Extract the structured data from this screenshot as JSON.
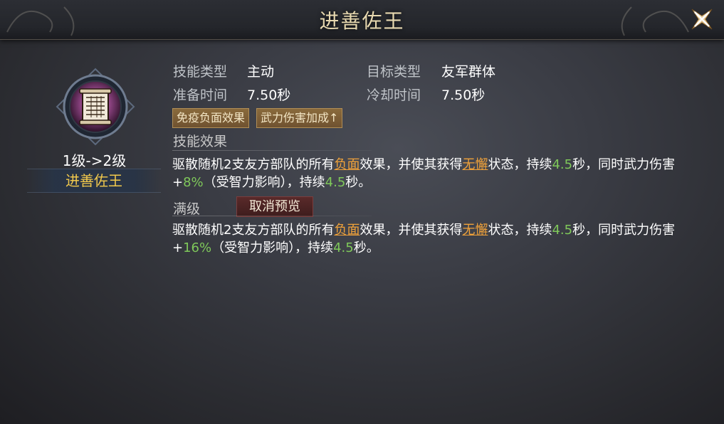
{
  "window": {
    "title": "进善佐王"
  },
  "skill": {
    "level_change": "1级->2级",
    "name": "进善佐王",
    "icon": "scroll-icon"
  },
  "stats": {
    "skill_type_label": "技能类型",
    "skill_type_value": "主动",
    "target_type_label": "目标类型",
    "target_type_value": "友军群体",
    "prep_time_label": "准备时间",
    "prep_time_value": "7.50秒",
    "cooldown_label": "冷却时间",
    "cooldown_value": "7.50秒"
  },
  "tags": [
    "免疫负面效果",
    "武力伤害加成↑"
  ],
  "effect_section": {
    "title": "技能效果",
    "parts": {
      "p1": "驱散随机2支友方部队的所有",
      "neg": "负面",
      "p2": "效果，并使其获得",
      "status": "无懈",
      "p3": "状态，持续",
      "dur1": "4.5",
      "p4": "秒，同时武力伤害+",
      "pct": "8%",
      "p5": "（受智力影响），持续",
      "dur2": "4.5",
      "p6": "秒。"
    }
  },
  "max_section": {
    "title": "满级",
    "cancel_preview": "取消预览",
    "parts": {
      "p1": "驱散随机2支友方部队的所有",
      "neg": "负面",
      "p2": "效果，并使其获得",
      "status": "无懈",
      "p3": "状态，持续",
      "dur1": "4.5",
      "p4": "秒，同时武力伤害+",
      "pct": "16%",
      "p5": "（受智力影响），持续",
      "dur2": "4.5",
      "p6": "秒。"
    }
  },
  "colors": {
    "title": "#e8d9b0",
    "skill_name": "#f2c94c",
    "highlight_orange": "#f0a23a",
    "highlight_green": "#7fc85a",
    "tag_bg": "#7a5c34"
  }
}
